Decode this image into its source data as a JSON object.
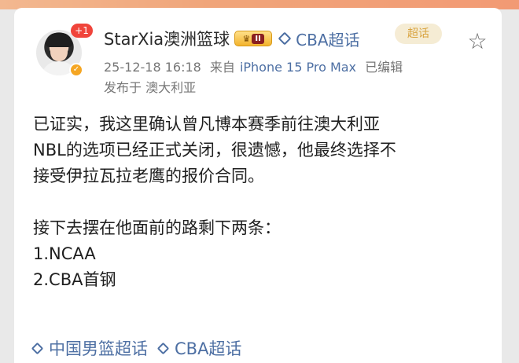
{
  "post": {
    "author": {
      "username": "StarXia澳洲篮球",
      "notif_count": "+1",
      "level_label": "II"
    },
    "header_topic": "CBA超话",
    "topic_badge": "超话",
    "meta": {
      "timestamp": "25-12-18 16:18",
      "source_prefix": "来自",
      "device": "iPhone 15 Pro Max",
      "edited": "已编辑"
    },
    "location": "发布于 澳大利亚",
    "body": {
      "line1": "已证实，我这里确认曾凡博本赛季前往澳大利亚",
      "line2": "NBL的选项已经正式关闭，很遗憾，他最终选择不",
      "line3": "接受伊拉瓦拉老鹰的报价合同。",
      "line4": "接下去摆在他面前的路剩下两条：",
      "line5": "1.NCAA",
      "line6": "2.CBA首钢"
    },
    "topics": [
      {
        "label": "中国男篮超话"
      },
      {
        "label": "CBA超话"
      }
    ]
  },
  "colors": {
    "link": "#4d6fa3",
    "accent_badge": "#f0443b",
    "verified": "#f5a623"
  },
  "icons": [
    "diamond-icon",
    "star-icon",
    "crown-icon",
    "verified-icon"
  ]
}
